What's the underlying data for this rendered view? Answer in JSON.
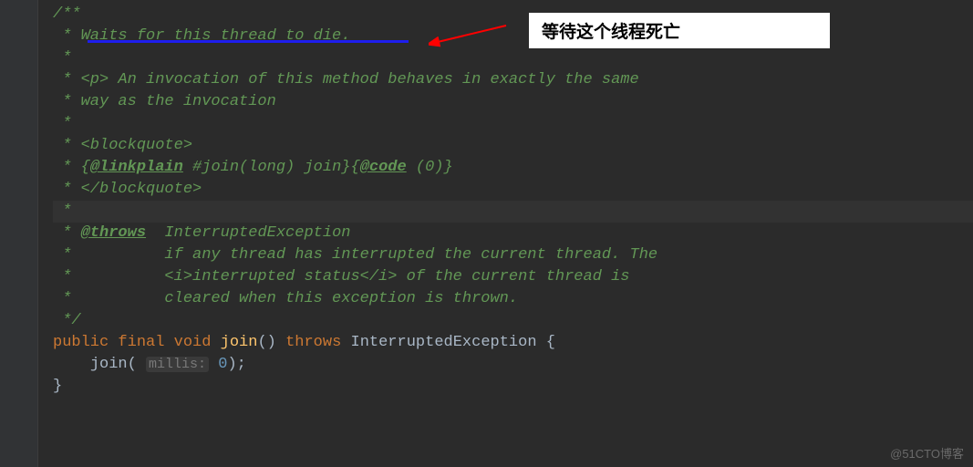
{
  "annotation": {
    "box_text": "等待这个线程死亡"
  },
  "code": {
    "lines": [
      {
        "type": "comment",
        "text": "/**"
      },
      {
        "type": "comment",
        "text": " * Waits for this thread to die."
      },
      {
        "type": "comment",
        "text": " *"
      },
      {
        "type": "comment",
        "text": " * <p> An invocation of this method behaves in exactly the same"
      },
      {
        "type": "comment",
        "text": " * way as the invocation"
      },
      {
        "type": "comment",
        "text": " *"
      },
      {
        "type": "comment",
        "text": " * <blockquote>"
      },
      {
        "type": "linkplain",
        "prefix": " * {",
        "tag": "@linkplain",
        "mid": " #join(long) join}{",
        "tag2": "@code",
        "suffix": " (0)}"
      },
      {
        "type": "comment",
        "text": " * </blockquote>"
      },
      {
        "type": "comment",
        "text": " *",
        "highlighted": true
      },
      {
        "type": "throws",
        "prefix": " * ",
        "tag": "@throws",
        "suffix": "  InterruptedException"
      },
      {
        "type": "comment",
        "text": " *          if any thread has interrupted the current thread. The"
      },
      {
        "type": "comment",
        "text": " *          <i>interrupted status</i> of the current thread is"
      },
      {
        "type": "comment",
        "text": " *          cleared when this exception is thrown."
      },
      {
        "type": "comment",
        "text": " */"
      }
    ],
    "signature": {
      "public": "public",
      "final": "final",
      "void": "void",
      "method_name": "join",
      "parens": "()",
      "throws": "throws",
      "exception": "InterruptedException",
      "brace_open": "{",
      "call_method": "join",
      "call_open": "(",
      "param_hint": "millis:",
      "call_value": "0",
      "call_close": ")",
      "semicolon": ";",
      "brace_close": "}"
    }
  },
  "watermark": "@51CTO博客"
}
